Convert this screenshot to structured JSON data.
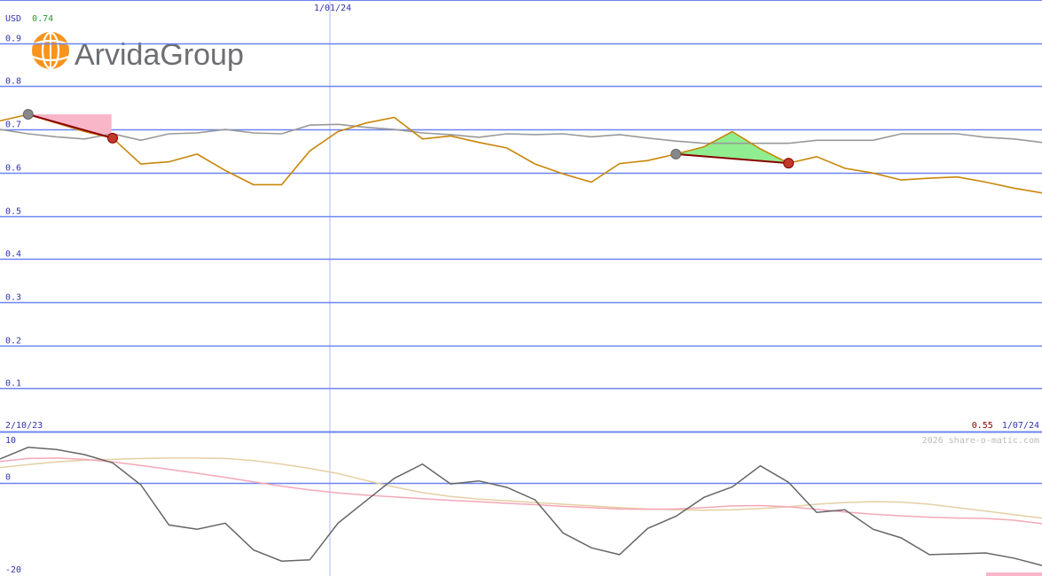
{
  "chart_data": [
    {
      "type": "line",
      "panel": "price",
      "currency": "USD",
      "current_price": "0.74",
      "last_price": "0.55",
      "start_date": "2/10/23",
      "end_date": "1/07/24",
      "marker_date": "1/01/24",
      "y_ticks": [
        "0.9",
        "0.8",
        "0.7",
        "0.6",
        "0.5",
        "0.4",
        "0.3",
        "0.2",
        "0.1"
      ],
      "ylim": [
        0,
        1.0
      ],
      "grid": true,
      "series": [
        {
          "color": "#c8860a",
          "values": [
            0.72,
            0.735,
            0.715,
            0.695,
            0.68,
            0.62,
            0.625,
            0.643,
            0.605,
            0.572,
            0.572,
            0.65,
            0.695,
            0.715,
            0.728,
            0.678,
            0.685,
            0.67,
            0.657,
            0.62,
            0.597,
            0.578,
            0.621,
            0.628,
            0.643,
            0.66,
            0.695,
            0.655,
            0.622,
            0.637,
            0.61,
            0.599,
            0.583,
            0.587,
            0.59,
            0.578,
            0.564,
            0.553
          ]
        },
        {
          "color": "#999999",
          "values": [
            0.7,
            0.69,
            0.683,
            0.678,
            0.69,
            0.675,
            0.69,
            0.692,
            0.7,
            0.692,
            0.69,
            0.71,
            0.712,
            0.705,
            0.7,
            0.692,
            0.688,
            0.682,
            0.69,
            0.688,
            0.69,
            0.683,
            0.688,
            0.68,
            0.673,
            0.668,
            0.668,
            0.668,
            0.668,
            0.675,
            0.675,
            0.675,
            0.69,
            0.69,
            0.69,
            0.682,
            0.678,
            0.67
          ]
        }
      ],
      "signals": [
        {
          "from_index": 1,
          "to_index": 4,
          "kind": "sell"
        },
        {
          "from_index": 24,
          "to_index": 28,
          "kind": "sell"
        }
      ]
    },
    {
      "type": "line",
      "panel": "oscillator",
      "y_ticks": [
        "10",
        "0",
        "-20"
      ],
      "ylim": [
        -20,
        10
      ],
      "series": [
        {
          "color": "#666666",
          "values": [
            5.5,
            8.2,
            7.7,
            6.5,
            4.6,
            -0.5,
            -9.8,
            -10.8,
            -9.4,
            -15.6,
            -18.2,
            -17.9,
            -9.4,
            -4.2,
            1.0,
            4.3,
            -0.3,
            0.4,
            -1.1,
            -4.0,
            -11.7,
            -15.1,
            -16.7,
            -10.6,
            -7.8,
            -3.4,
            -1.0,
            3.9,
            0.1,
            -6.9,
            -6.3,
            -10.8,
            -12.8,
            -16.7,
            -16.5,
            -16.3,
            -17.5,
            -19.2
          ]
        },
        {
          "color": "#f4a7b9",
          "values": [
            4.9,
            5.6,
            5.7,
            5.4,
            4.8,
            4.0,
            3.1,
            2.2,
            1.2,
            0.2,
            -0.8,
            -1.7,
            -2.4,
            -2.9,
            -3.3,
            -3.7,
            -4.1,
            -4.4,
            -4.8,
            -5.1,
            -5.5,
            -5.8,
            -6.1,
            -6.2,
            -6.1,
            -5.8,
            -5.4,
            -5.3,
            -5.6,
            -6.2,
            -6.8,
            -7.3,
            -7.7,
            -8.0,
            -8.2,
            -8.3,
            -8.7,
            -9.5
          ]
        },
        {
          "color": "#e6cfa2",
          "values": [
            3.5,
            4.2,
            4.8,
            5.2,
            5.4,
            5.6,
            5.7,
            5.7,
            5.6,
            5.1,
            4.3,
            3.3,
            2.1,
            0.5,
            -1.0,
            -2.3,
            -3.2,
            -3.8,
            -4.2,
            -4.6,
            -5.0,
            -5.4,
            -5.8,
            -6.1,
            -6.3,
            -6.4,
            -6.3,
            -6.0,
            -5.6,
            -5.0,
            -4.6,
            -4.4,
            -4.5,
            -5.0,
            -5.8,
            -6.6,
            -7.4,
            -8.2
          ]
        }
      ]
    }
  ],
  "logo": {
    "text_a": "Arvida",
    "text_b": "Group",
    "accent": "#f7941d",
    "text_color": "#6d6e71"
  },
  "credit": "2026 share-o-matic.com",
  "colors": {
    "grid": "#6c85f0",
    "axis_text": "#3333aa",
    "price_text": "#2a9a2a",
    "sell_fill": "#f9b6c8",
    "buy_fill": "#90ee90",
    "signal_line": "#8b0000"
  }
}
